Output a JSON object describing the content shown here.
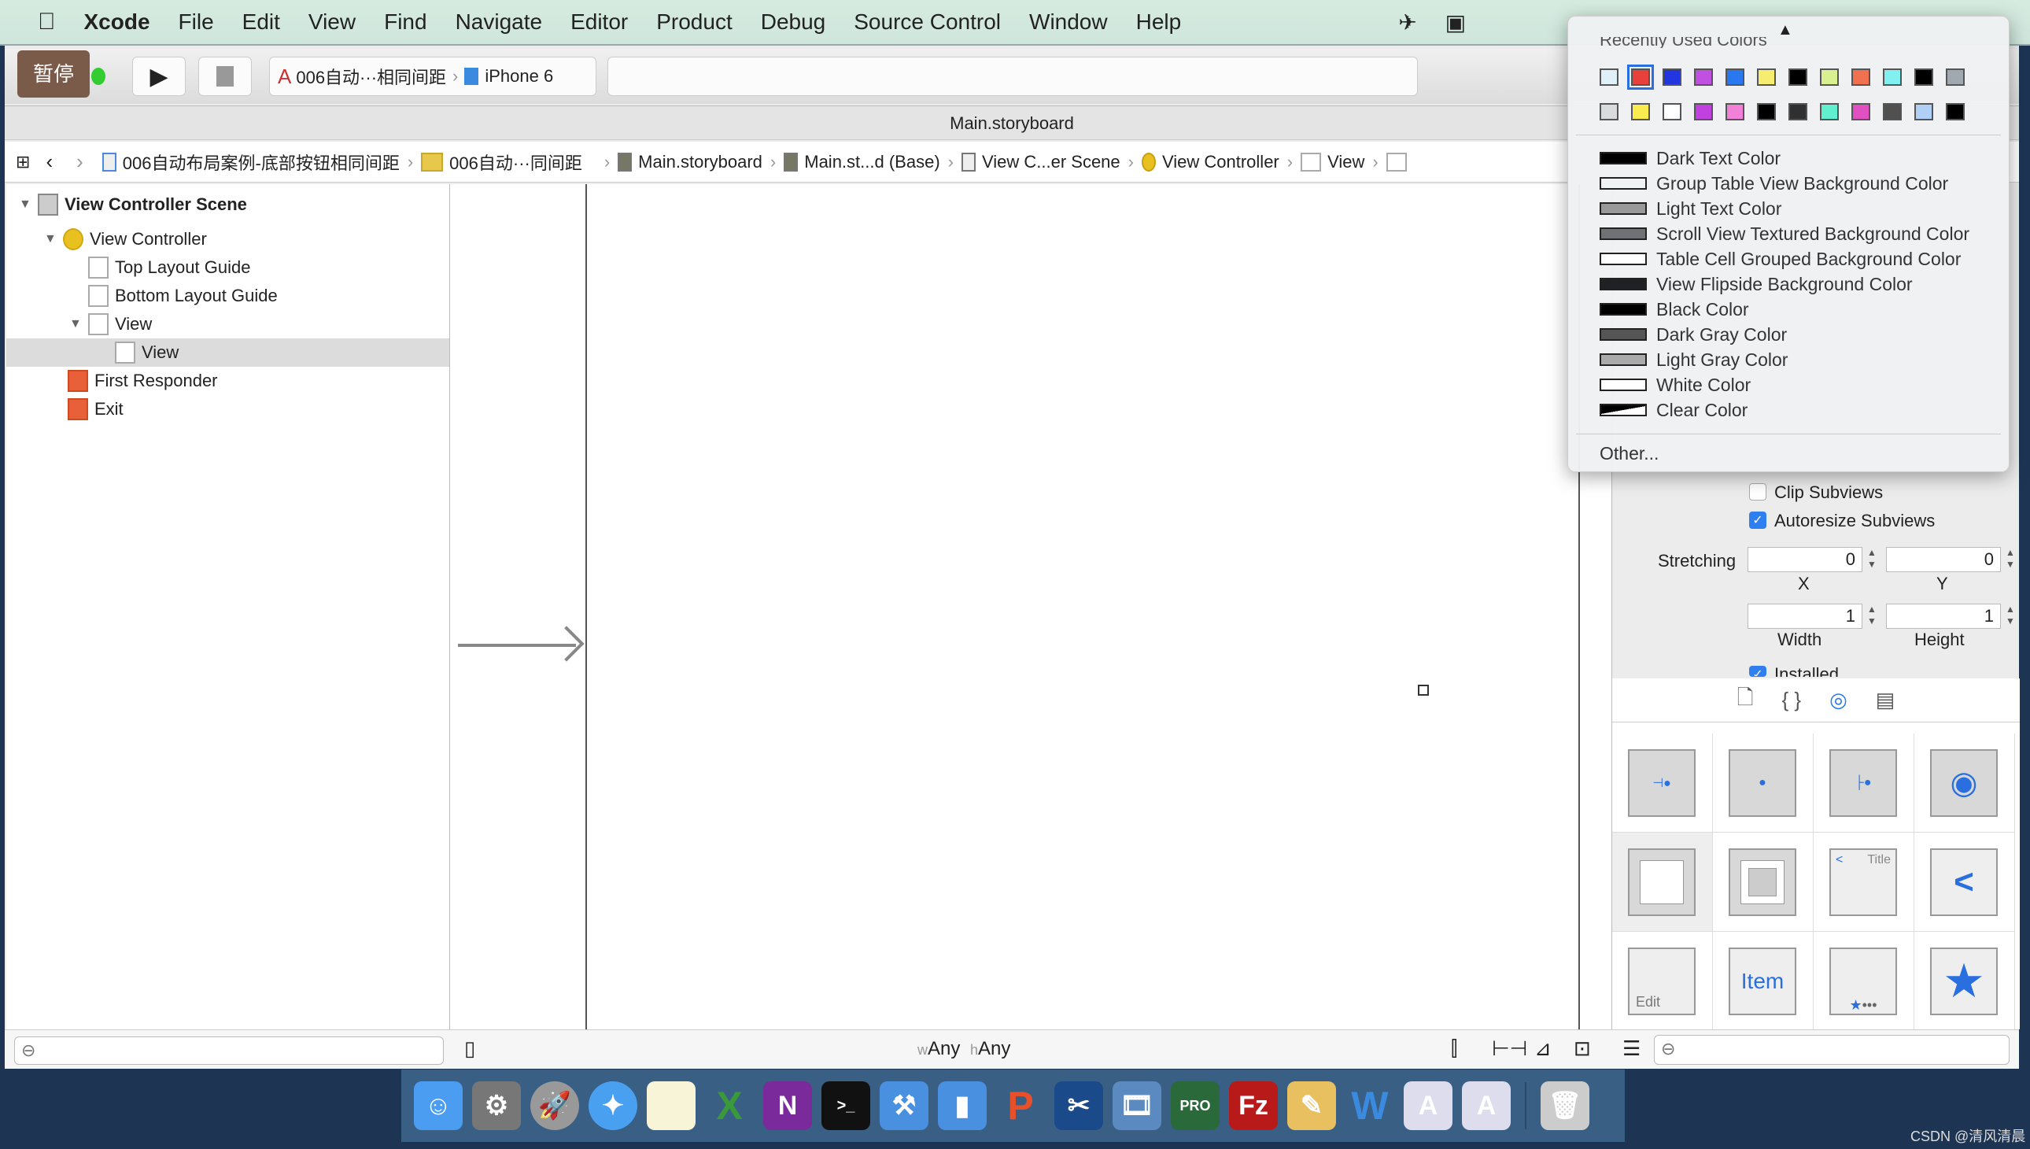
{
  "menubar": {
    "items": [
      "Xcode",
      "File",
      "Edit",
      "View",
      "Find",
      "Navigate",
      "Editor",
      "Product",
      "Debug",
      "Source Control",
      "Window",
      "Help"
    ]
  },
  "toolbar": {
    "pause_label": "暂停",
    "scheme": "006自动···相同间距",
    "device": "iPhone 6"
  },
  "tab_title": "Main.storyboard",
  "jumpbar": [
    "006自动布局案例-底部按钮相同间距",
    "006自动···同间距",
    "Main.storyboard",
    "Main.st...d (Base)",
    "View C...er Scene",
    "View Controller",
    "View"
  ],
  "navigator": {
    "items": [
      {
        "label": "View Controller Scene",
        "depth": 0,
        "expanded": true,
        "bold": true
      },
      {
        "label": "View Controller",
        "depth": 1,
        "expanded": true
      },
      {
        "label": "Top Layout Guide",
        "depth": 2
      },
      {
        "label": "Bottom Layout Guide",
        "depth": 2
      },
      {
        "label": "View",
        "depth": 2,
        "expanded": true
      },
      {
        "label": "View",
        "depth": 3,
        "selected": true
      },
      {
        "label": "First Responder",
        "depth": 1
      },
      {
        "label": "Exit",
        "depth": 1
      }
    ]
  },
  "canvas": {
    "size_class": {
      "w": "w",
      "w_val": "Any",
      "h": "h",
      "h_val": "Any"
    }
  },
  "color_popup": {
    "section_title": "Recently Used Colors",
    "recent_row1": [
      "#dff0f8",
      "#e8403a",
      "#2236e0",
      "#c050e0",
      "#2a78f0",
      "#f6ec70",
      "#000000",
      "#d8f090",
      "#f07050",
      "#80f0f0",
      "#000000",
      "#a0a8b0"
    ],
    "recent_row2": [
      "#d8dcdc",
      "#f8ec50",
      "#ffffff",
      "#c040e0",
      "#f080d8",
      "#000000",
      "#303030",
      "#60f0d0",
      "#e050c0",
      "#505050",
      "#b0d0f8",
      "#000000"
    ],
    "selected_index": 1,
    "named_colors": [
      {
        "label": "Dark Text Color",
        "color": "#000000"
      },
      {
        "label": "Group Table View Background Color",
        "color": "#eff3f4"
      },
      {
        "label": "Light Text Color",
        "color": "#999999"
      },
      {
        "label": "Scroll View Textured Background Color",
        "color": "#6f7175"
      },
      {
        "label": "Table Cell Grouped Background Color",
        "color": "#ffffff"
      },
      {
        "label": "View Flipside Background Color",
        "color": "#1f2124"
      },
      {
        "label": "Black Color",
        "color": "#000000"
      },
      {
        "label": "Dark Gray Color",
        "color": "#555555"
      },
      {
        "label": "Light Gray Color",
        "color": "#aaaaaa"
      },
      {
        "label": "White Color",
        "color": "#ffffff"
      },
      {
        "label": "Clear Color",
        "color": "transparent"
      }
    ],
    "other_label": "Other..."
  },
  "inspector": {
    "clip_subviews": {
      "label": "Clip Subviews",
      "checked": false
    },
    "autoresize_subviews": {
      "label": "Autoresize Subviews",
      "checked": true
    },
    "stretching_label": "Stretching",
    "x": "0",
    "y": "0",
    "width": "1",
    "height": "1",
    "x_label": "X",
    "y_label": "Y",
    "width_label": "Width",
    "height_label": "Height",
    "installed_label": "Installed"
  },
  "library": {
    "labels": {
      "title": "Title",
      "edit": "Edit",
      "item": "Item"
    }
  },
  "watermark": "CSDN @清风清晨"
}
